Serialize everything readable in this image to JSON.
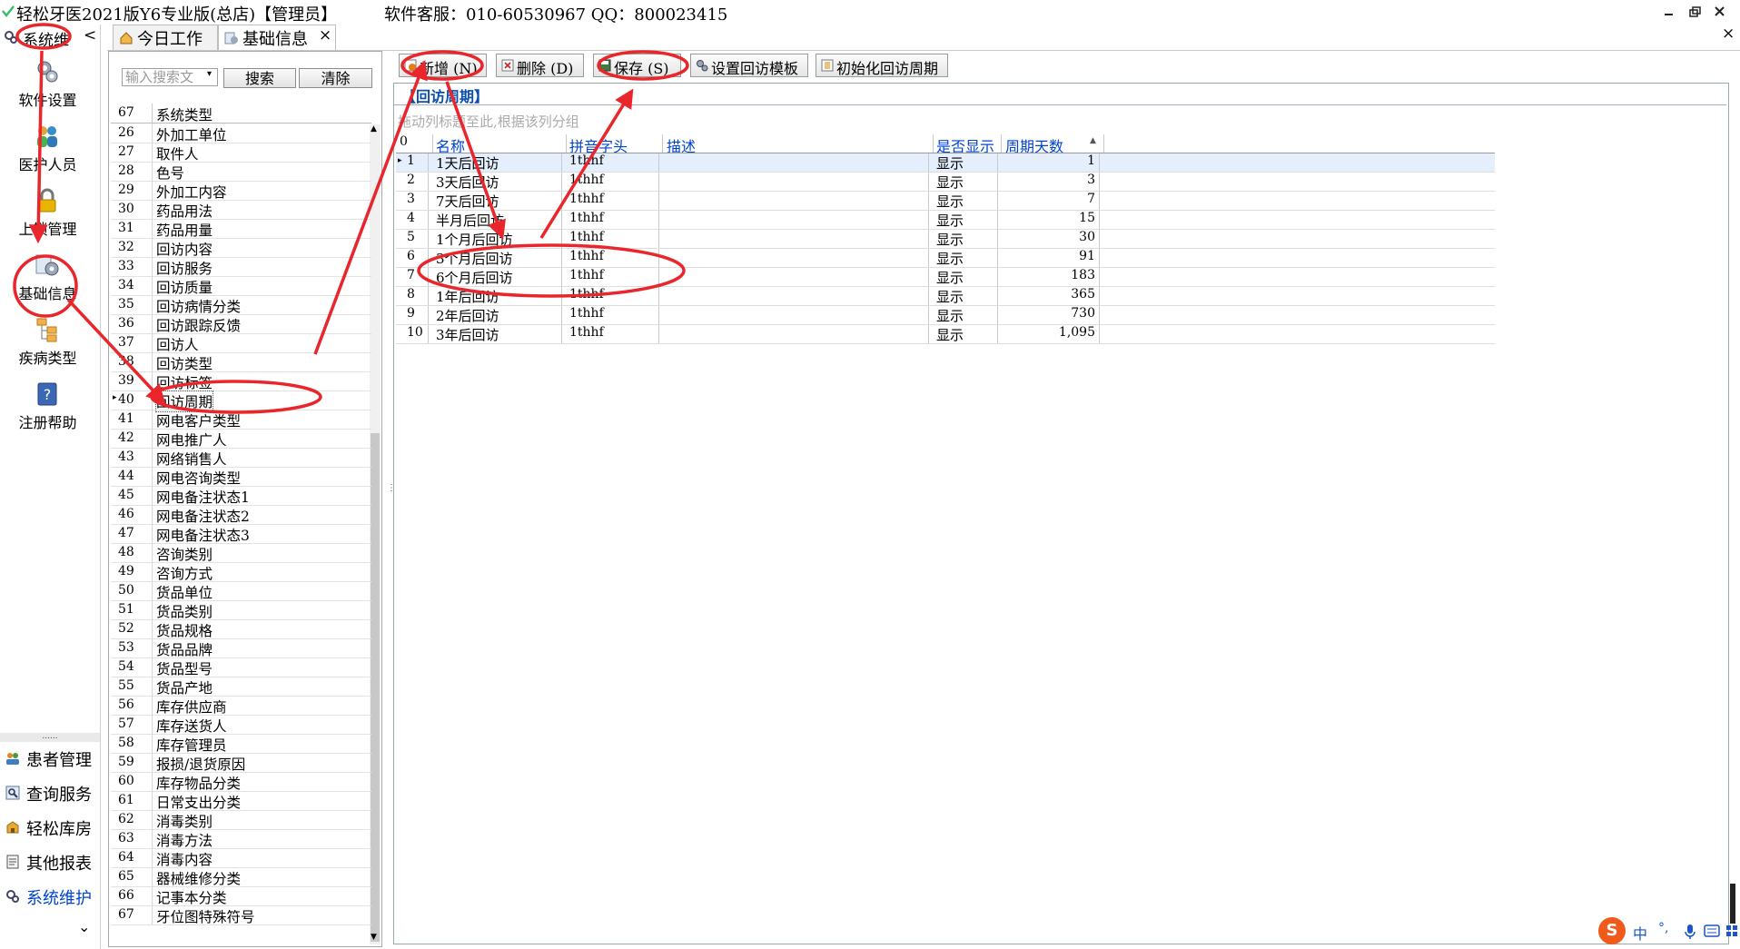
{
  "window": {
    "title": "轻松牙医2021版Y6专业版(总店)【管理员】",
    "service": "软件客服：010-60530967 QQ：800023415",
    "controls": [
      "minimize",
      "restore",
      "close"
    ]
  },
  "leftnav": {
    "header": "系统维",
    "collapse_glyph": "<",
    "items": [
      {
        "label": "软件设置",
        "icon": "gear-icon"
      },
      {
        "label": "医护人员",
        "icon": "staff-icon"
      },
      {
        "label": "上锁管理",
        "icon": "lock-icon"
      },
      {
        "label": "基础信息",
        "icon": "settings-info-icon"
      },
      {
        "label": "疾病类型",
        "icon": "tree-icon"
      },
      {
        "label": "注册帮助",
        "icon": "help-icon"
      }
    ],
    "dots": "......",
    "bottom": [
      {
        "label": "患者管理",
        "icon": "patients-icon"
      },
      {
        "label": "查询服务",
        "icon": "query-icon"
      },
      {
        "label": "轻松库房",
        "icon": "warehouse-icon"
      },
      {
        "label": "其他报表",
        "icon": "report-icon"
      },
      {
        "label": "系统维护",
        "icon": "maintenance-icon"
      }
    ],
    "more_glyph": "⌄"
  },
  "tabs": [
    {
      "label": "今日工作",
      "icon": "home-icon"
    },
    {
      "label": "基础信息",
      "icon": "info-icon",
      "closable": true
    }
  ],
  "tab_close_glyph": "×",
  "far_close_glyph": "×",
  "search": {
    "placeholder": "输入搜索文",
    "search_btn": "搜索",
    "clear_btn": "清除"
  },
  "list": {
    "header_num": "67",
    "header_label": "系统类型",
    "rows": [
      [
        "26",
        "外加工单位"
      ],
      [
        "27",
        "取件人"
      ],
      [
        "28",
        "色号"
      ],
      [
        "29",
        "外加工内容"
      ],
      [
        "30",
        "药品用法"
      ],
      [
        "31",
        "药品用量"
      ],
      [
        "32",
        "回访内容"
      ],
      [
        "33",
        "回访服务"
      ],
      [
        "34",
        "回访质量"
      ],
      [
        "35",
        "回访病情分类"
      ],
      [
        "36",
        "回访跟踪反馈"
      ],
      [
        "37",
        "回访人"
      ],
      [
        "38",
        "回访类型"
      ],
      [
        "39",
        "回访标签"
      ],
      [
        "40",
        "回访周期"
      ],
      [
        "41",
        "网电客户类型"
      ],
      [
        "42",
        "网电推广人"
      ],
      [
        "43",
        "网络销售人"
      ],
      [
        "44",
        "网电咨询类型"
      ],
      [
        "45",
        "网电备注状态1"
      ],
      [
        "46",
        "网电备注状态2"
      ],
      [
        "47",
        "网电备注状态3"
      ],
      [
        "48",
        "咨询类别"
      ],
      [
        "49",
        "咨询方式"
      ],
      [
        "50",
        "货品单位"
      ],
      [
        "51",
        "货品类别"
      ],
      [
        "52",
        "货品规格"
      ],
      [
        "53",
        "货品品牌"
      ],
      [
        "54",
        "货品型号"
      ],
      [
        "55",
        "货品产地"
      ],
      [
        "56",
        "库存供应商"
      ],
      [
        "57",
        "库存送货人"
      ],
      [
        "58",
        "库存管理员"
      ],
      [
        "59",
        "报损/退货原因"
      ],
      [
        "60",
        "库存物品分类"
      ],
      [
        "61",
        "日常支出分类"
      ],
      [
        "62",
        "消毒类别"
      ],
      [
        "63",
        "消毒方法"
      ],
      [
        "64",
        "消毒内容"
      ],
      [
        "65",
        "器械维修分类"
      ],
      [
        "66",
        "记事本分类"
      ],
      [
        "67",
        "牙位图特殊符号"
      ]
    ],
    "selected_index": 14
  },
  "toolbar": {
    "add": "新增 (N)",
    "delete": "删除 (D)",
    "save": "保存 (S)",
    "template": "设置回访模板",
    "init": "初始化回访周期"
  },
  "grid": {
    "title": "【回访周期】",
    "group_hint": "拖动列标题至此,根据该列分组",
    "columns": [
      "0",
      "名称",
      "拼音字头",
      "描述",
      "是否显示",
      "周期天数"
    ],
    "rows": [
      [
        "1",
        "1天后回访",
        "1thhf",
        "",
        "显示",
        "1"
      ],
      [
        "2",
        "3天后回访",
        "1thhf",
        "",
        "显示",
        "3"
      ],
      [
        "3",
        "7天后回访",
        "1thhf",
        "",
        "显示",
        "7"
      ],
      [
        "4",
        "半月后回访",
        "1thhf",
        "",
        "显示",
        "15"
      ],
      [
        "5",
        "1个月后回访",
        "1thhf",
        "",
        "显示",
        "30"
      ],
      [
        "6",
        "3个月后回访",
        "1thhf",
        "",
        "显示",
        "91"
      ],
      [
        "7",
        "6个月后回访",
        "1thhf",
        "",
        "显示",
        "183"
      ],
      [
        "8",
        "1年后回访",
        "1thhf",
        "",
        "显示",
        "365"
      ],
      [
        "9",
        "2年后回访",
        "1thhf",
        "",
        "显示",
        "730"
      ],
      [
        "10",
        "3年后回访",
        "1thhf",
        "",
        "显示",
        "1,095"
      ]
    ]
  },
  "ime": {
    "brand": "S",
    "lang": "中",
    "punct": "°,",
    "mic": "mic-icon",
    "keyboard": "keyboard-icon",
    "grid": "grid-icon"
  },
  "colors": {
    "annotation": "#e8262b",
    "accent": "#0044cc",
    "title_blue": "#0a4fb0"
  }
}
